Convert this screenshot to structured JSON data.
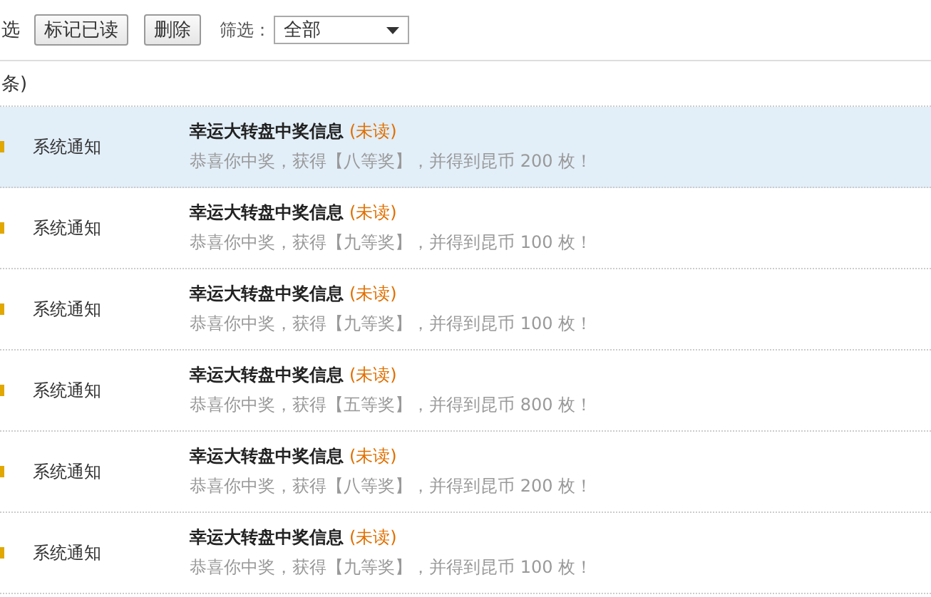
{
  "toolbar": {
    "select_all_label": "选",
    "buttons": [
      "标记已读",
      "删除"
    ],
    "filter": {
      "label": "筛选：",
      "value": "全部"
    }
  },
  "count_text": "条)",
  "rows": [
    {
      "category": "系统通知",
      "title": "幸运大转盘中奖信息",
      "status": "(未读)",
      "message": "恭喜你中奖，获得【八等奖】，并得到昆币 200 枚！",
      "highlighted": true
    },
    {
      "category": "系统通知",
      "title": "幸运大转盘中奖信息",
      "status": "(未读)",
      "message": "恭喜你中奖，获得【九等奖】，并得到昆币 100 枚！",
      "highlighted": false
    },
    {
      "category": "系统通知",
      "title": "幸运大转盘中奖信息",
      "status": "(未读)",
      "message": "恭喜你中奖，获得【九等奖】，并得到昆币 100 枚！",
      "highlighted": false
    },
    {
      "category": "系统通知",
      "title": "幸运大转盘中奖信息",
      "status": "(未读)",
      "message": "恭喜你中奖，获得【五等奖】，并得到昆币 800 枚！",
      "highlighted": false
    },
    {
      "category": "系统通知",
      "title": "幸运大转盘中奖信息",
      "status": "(未读)",
      "message": "恭喜你中奖，获得【八等奖】，并得到昆币 200 枚！",
      "highlighted": false
    },
    {
      "category": "系统通知",
      "title": "幸运大转盘中奖信息",
      "status": "(未读)",
      "message": "恭喜你中奖，获得【九等奖】，并得到昆币 100 枚！",
      "highlighted": false
    }
  ]
}
